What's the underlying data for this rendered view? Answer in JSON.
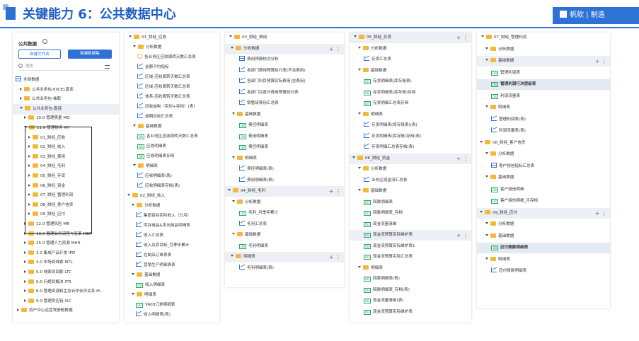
{
  "header": {
    "title": "关键能力 6：公共数据中心",
    "logo": "帆软 | 制造"
  },
  "p1": {
    "title": "公共数据",
    "btn_folder": "新建文件夹",
    "btn_dataset": "新建数据集",
    "search_placeholder": "搜索",
    "items": [
      "全部数据",
      "公共业务包-EXCEL直连",
      "公共业务包-抽取",
      "公共业务包-直连",
      "10.0 管理质量 MQ",
      "11.0 管理财务 MF",
      "01_财经_应收",
      "02_财经_收入",
      "03_财经_费用",
      "04_财经_毛利",
      "05_财经_存货",
      "06_财经_资金",
      "07_财经_管理利润",
      "08_财经_客户信贷",
      "09_财经_应付",
      "12.0 管理风险 MR",
      "13.0 管理业务流程与变革 MBP",
      "15.0 管理人力资源 MHR",
      "3.0 集成产品开发 IPD",
      "4.0 市场到线索 MTL",
      "5.0 线索到回款 LTC",
      "6.0 问题到解决 ITR",
      "8.0 管理资源和生态合作伙伴关系 M...",
      "9.0 管理供应链 ISC",
      "资产中心运营驾驶舱数据"
    ]
  },
  "p2": {
    "items": [
      "01_财经_应收",
      "分析数据",
      "各业务区应收周转天数汇总表",
      "金额平均指标",
      "区域-应收周转天数汇总表",
      "区域-应收周转天数汇总表",
      "体系-应收周转天数汇总表",
      "应收结构（实时+存档）(表)",
      "逾期应收汇总表",
      "基础数据",
      "各业务区应收周转天数汇总表",
      "应收明细表",
      "应收明细表存档",
      "明细表",
      "应收明细表(表)",
      "应收明细表存档(表)",
      "02_财经_收入",
      "分析数据",
      "集团目标实际收入（分月）",
      "库存商品&发出商品明细表",
      "收入汇总表",
      "收入及其目标_月季年累计",
      "在制品订单表表",
      "营销生产明细表表",
      "基础数据",
      "收入明细表",
      "明细表",
      "VA03订单明细表",
      "收入明细表(表)"
    ]
  },
  "p3": {
    "items": [
      "03_财经_费用",
      "分析数据",
      "费用预算核对分析",
      "各部门费用预算执行表(不含费用)",
      "各部门科目预算实际费用(含费用)",
      "各部门月度计费用预算执行表",
      "销管研费用汇总表",
      "基础数据",
      "费控明细表",
      "费用明细表",
      "费控明细表",
      "明细表",
      "费控明细表(表)",
      "费用明细表(表)",
      "04_财经_毛利",
      "分析数据",
      "毛利_月季年累计",
      "毛利汇总表",
      "基础数据",
      "毛利明细表",
      "明细表",
      "毛利明细表(表)"
    ]
  },
  "p4": {
    "items": [
      "05_财经_存货",
      "分析数据",
      "存货汇总表",
      "基础数据",
      "存货明细表(库存账表)",
      "存货明细表(库存账)存档",
      "存货明细汇总表存档",
      "明细表",
      "存货明细表(库存账表)(表)",
      "存货明细表(库存账)存档(表)",
      "存货明细汇总表存档(表)",
      "06_财经_资金",
      "分析数据",
      "业务区现金流汇总表",
      "基础数据",
      "回款明细表",
      "回款明细表_存档",
      "现金流量清单",
      "现金流预算实际维护表",
      "现金流预算实际维护表1",
      "现金流预算实际汇总表",
      "明细表",
      "回款明细表(表)",
      "回款明细表_存档(表)",
      "现金流量清单(表)",
      "现金流预算实际维护表"
    ]
  },
  "p5": {
    "items": [
      "07_财经_管理利润",
      "分析数据",
      "基础数据",
      "管理利润表",
      "管理利润行次层级表",
      "利润流量表",
      "明细表",
      "管理利润表(表)",
      "利润流量表(表)",
      "08_财经_客户信贷",
      "分析数据",
      "客户授信指标汇总表",
      "基础数据",
      "客户授信明细",
      "客户授信明细_月存档",
      "09_财经_应付",
      "分析数据",
      "基础数据",
      "应付账款明细表",
      "明细表",
      "应付账款明细表"
    ]
  }
}
